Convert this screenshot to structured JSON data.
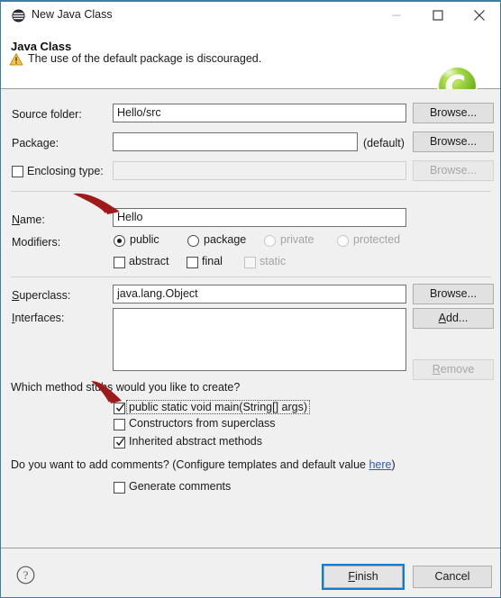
{
  "window": {
    "title": "New Java Class",
    "icon": "eclipse-sphere-icon",
    "controls": {
      "minimize": "minimize-icon",
      "maximize": "maximize-icon",
      "close": "close-icon"
    }
  },
  "header": {
    "title": "Java Class",
    "warning_icon": "warning-triangle-icon",
    "description": "The use of the default package is discouraged.",
    "logo": "green-c-sphere-logo"
  },
  "form": {
    "source_folder": {
      "label": "Source folder:",
      "value": "Hello/src",
      "placeholder": "",
      "browse": "Browse..."
    },
    "package": {
      "label": "Package:",
      "value": "",
      "placeholder": "",
      "suffix": "(default)",
      "browse": "Browse..."
    },
    "enclosing_type": {
      "label": "Enclosing type:",
      "checked": false,
      "value": "",
      "browse": "Browse...",
      "disabled": true
    },
    "name": {
      "label": "Name:",
      "value": "Hello",
      "placeholder": ""
    },
    "modifiers": {
      "label": "Modifiers:",
      "radios": [
        {
          "label": "public",
          "selected": true,
          "disabled": false,
          "accesskey": "p"
        },
        {
          "label": "package",
          "selected": false,
          "disabled": false,
          "accesskey": "c"
        },
        {
          "label": "private",
          "selected": false,
          "disabled": true,
          "accesskey": "v"
        },
        {
          "label": "protected",
          "selected": false,
          "disabled": true,
          "accesskey": "t"
        }
      ],
      "checkboxes": [
        {
          "label": "abstract",
          "checked": false,
          "disabled": false
        },
        {
          "label": "final",
          "checked": false,
          "disabled": false
        },
        {
          "label": "static",
          "checked": false,
          "disabled": true
        }
      ]
    },
    "superclass": {
      "label": "Superclass:",
      "value": "java.lang.Object",
      "browse": "Browse..."
    },
    "interfaces": {
      "label": "Interfaces:",
      "items": [],
      "add": "Add...",
      "remove": "Remove",
      "remove_disabled": true
    }
  },
  "stubs": {
    "question": "Which method stubs would you like to create?",
    "options": [
      {
        "label": "public static void main(String[] args)",
        "checked": true,
        "focused": true
      },
      {
        "label": "Constructors from superclass",
        "checked": false,
        "focused": false
      },
      {
        "label": "Inherited abstract methods",
        "checked": true,
        "focused": false
      }
    ]
  },
  "comments": {
    "question_prefix": "Do you want to add comments? (Configure templates and default value ",
    "link": "here",
    "question_suffix": ")",
    "checkbox": {
      "label": "Generate comments",
      "checked": false
    }
  },
  "footer": {
    "help_icon": "help-question-icon",
    "finish": "Finish",
    "cancel": "Cancel"
  },
  "annotations": {
    "arrow_color": "#9e1b1b",
    "arrows": [
      {
        "name": "arrow-to-name-field"
      },
      {
        "name": "arrow-to-main-stub"
      }
    ]
  },
  "colors": {
    "window_border": "#3b7f9b",
    "dialog_bg": "#f0f0f0",
    "focus_blue": "#0c7cd5",
    "link_blue": "#2b5fa8",
    "warning_yellow": "#f0b323",
    "logo_green": "#8cc63f"
  }
}
